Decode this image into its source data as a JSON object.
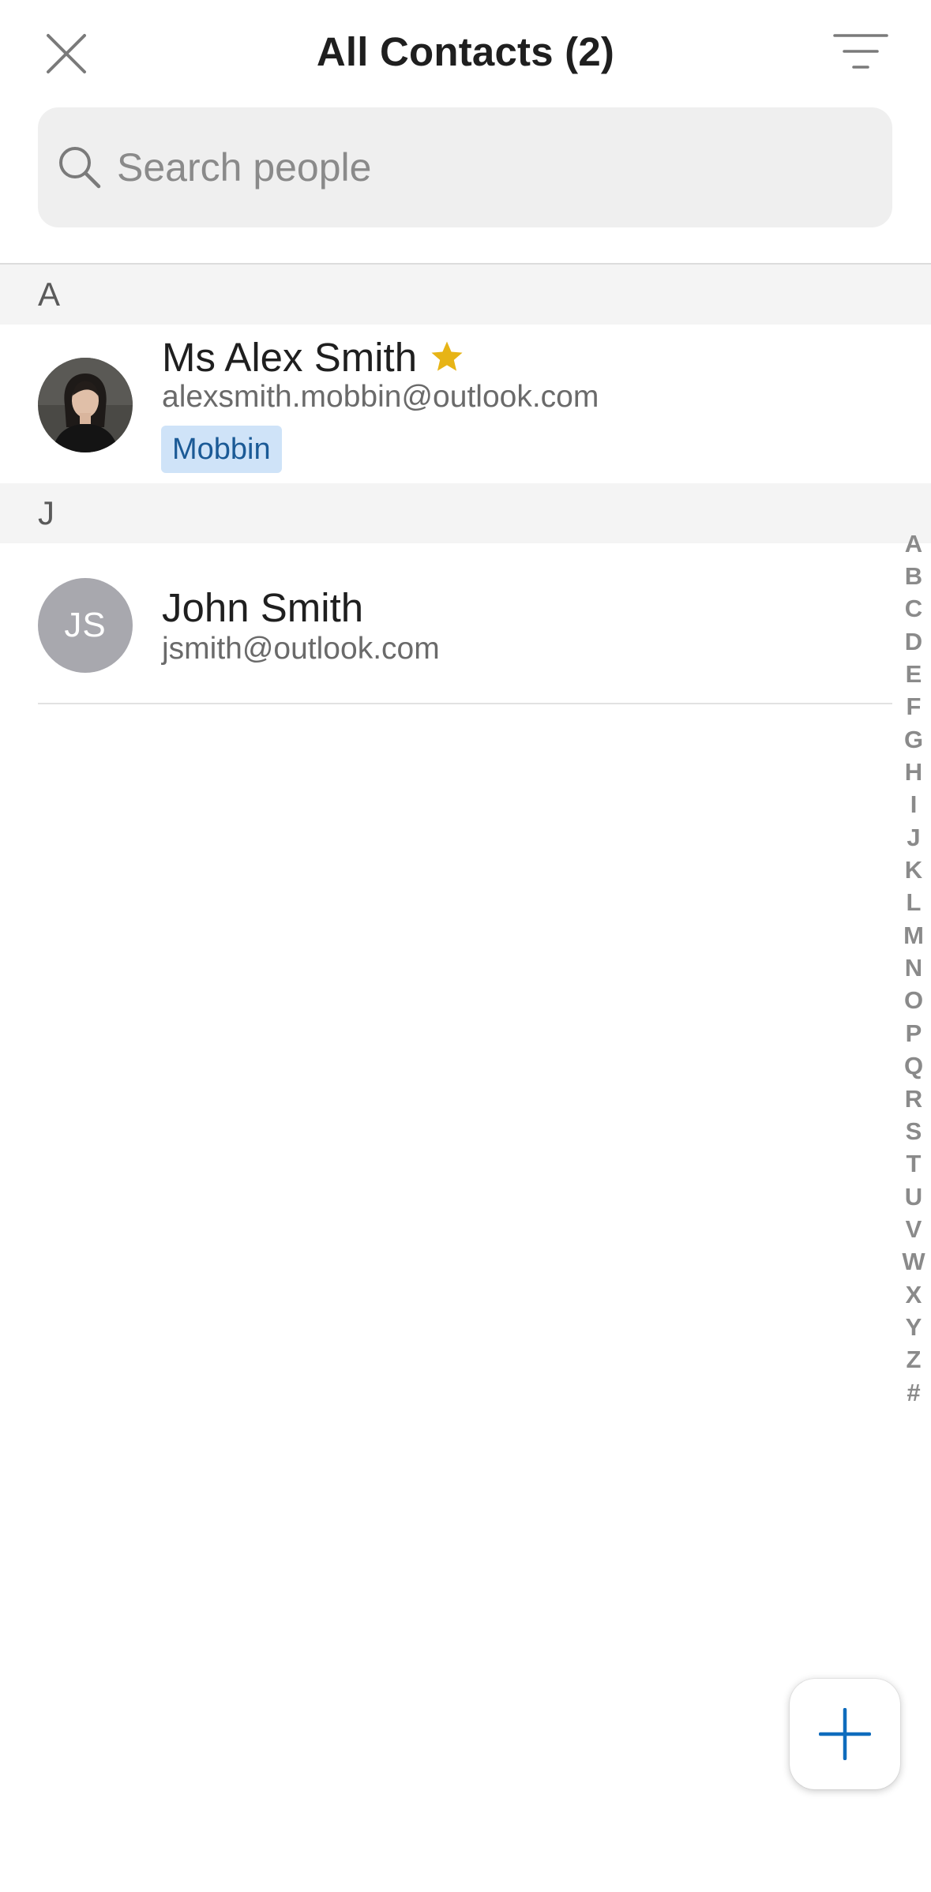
{
  "header": {
    "title": "All Contacts (2)",
    "close_icon": "close-icon",
    "filter_icon": "filter-icon"
  },
  "search": {
    "placeholder": "Search people",
    "value": "",
    "icon": "search-icon"
  },
  "sections": [
    {
      "letter": "A",
      "contacts": [
        {
          "name": "Ms Alex Smith",
          "email": "alexsmith.mobbin@outlook.com",
          "tag": "Mobbin",
          "favorite": true,
          "avatar": "photo"
        }
      ]
    },
    {
      "letter": "J",
      "contacts": [
        {
          "name": "John Smith",
          "email": "jsmith@outlook.com",
          "initials": "JS",
          "favorite": false,
          "avatar": "initials"
        }
      ]
    }
  ],
  "alphabet_index": [
    "A",
    "B",
    "C",
    "D",
    "E",
    "F",
    "G",
    "H",
    "I",
    "J",
    "K",
    "L",
    "M",
    "N",
    "O",
    "P",
    "Q",
    "R",
    "S",
    "T",
    "U",
    "V",
    "W",
    "X",
    "Y",
    "Z",
    "#"
  ],
  "fab": {
    "icon": "plus-icon"
  },
  "colors": {
    "accent": "#0f6cbd",
    "star": "#e7b416",
    "tag_bg": "#cfe3f8",
    "tag_text": "#1b5a96",
    "section_bg": "#f4f4f4",
    "search_bg": "#efefef",
    "initials_avatar_bg": "#a8a8ae"
  }
}
